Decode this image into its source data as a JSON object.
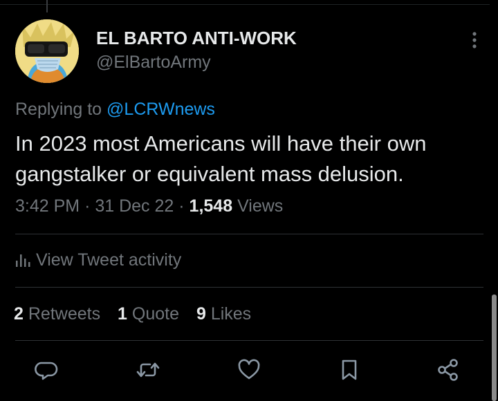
{
  "author": {
    "name": "EL BARTO ANTI-WORK",
    "handle": "@ElBartoArmy"
  },
  "reply": {
    "prefix": "Replying to",
    "mention": "@LCRWnews"
  },
  "tweet": {
    "line1": "In 2023 most Americans will have their own",
    "line2": "gangstalker or equivalent mass delusion."
  },
  "meta": {
    "time": "3:42 PM",
    "separator": "·",
    "date": "31 Dec 22",
    "views_count": "1,548",
    "views_label": "Views"
  },
  "activity": {
    "label": "View Tweet activity"
  },
  "stats": {
    "retweets": {
      "count": "2",
      "label": "Retweets"
    },
    "quotes": {
      "count": "1",
      "label": "Quote"
    },
    "likes": {
      "count": "9",
      "label": "Likes"
    }
  },
  "actions": [
    "reply-icon",
    "retweet-icon",
    "like-icon",
    "bookmark-icon",
    "share-icon"
  ],
  "colors": {
    "background": "#000000",
    "text": "#e7e9ea",
    "secondary": "#71767b",
    "accent": "#1d9bf0",
    "divider": "#2f3336"
  }
}
